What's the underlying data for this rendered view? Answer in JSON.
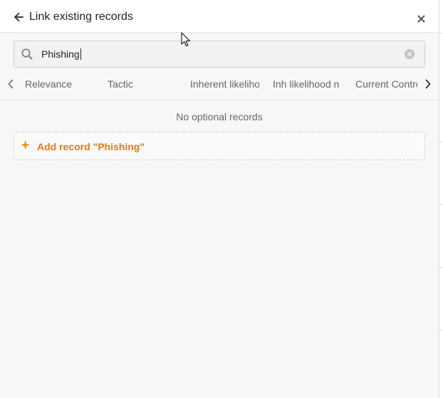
{
  "dialog": {
    "title": "Link existing records"
  },
  "search": {
    "value": "Phishing",
    "placeholder": ""
  },
  "columns": [
    {
      "label": "Relevance"
    },
    {
      "label": "Tactic"
    },
    {
      "label": "Inherent likelihood"
    },
    {
      "label": "Inh likelihood n"
    },
    {
      "label": "Current Controls"
    }
  ],
  "empty_state": {
    "message": "No optional records"
  },
  "add_record": {
    "plus": "+",
    "label": "Add record \"Phishing\""
  },
  "icons": {
    "back": "arrow-left-icon",
    "close": "close-icon",
    "search": "search-icon",
    "clear": "clear-circle-icon",
    "scroll_left": "chevron-left-icon",
    "scroll_right": "chevron-right-icon",
    "pointer": "mouse-pointer-icon"
  },
  "colors": {
    "accent": "#e57a16",
    "text": "#212529",
    "muted": "#666666",
    "panel_bg": "#f7f7f7"
  }
}
